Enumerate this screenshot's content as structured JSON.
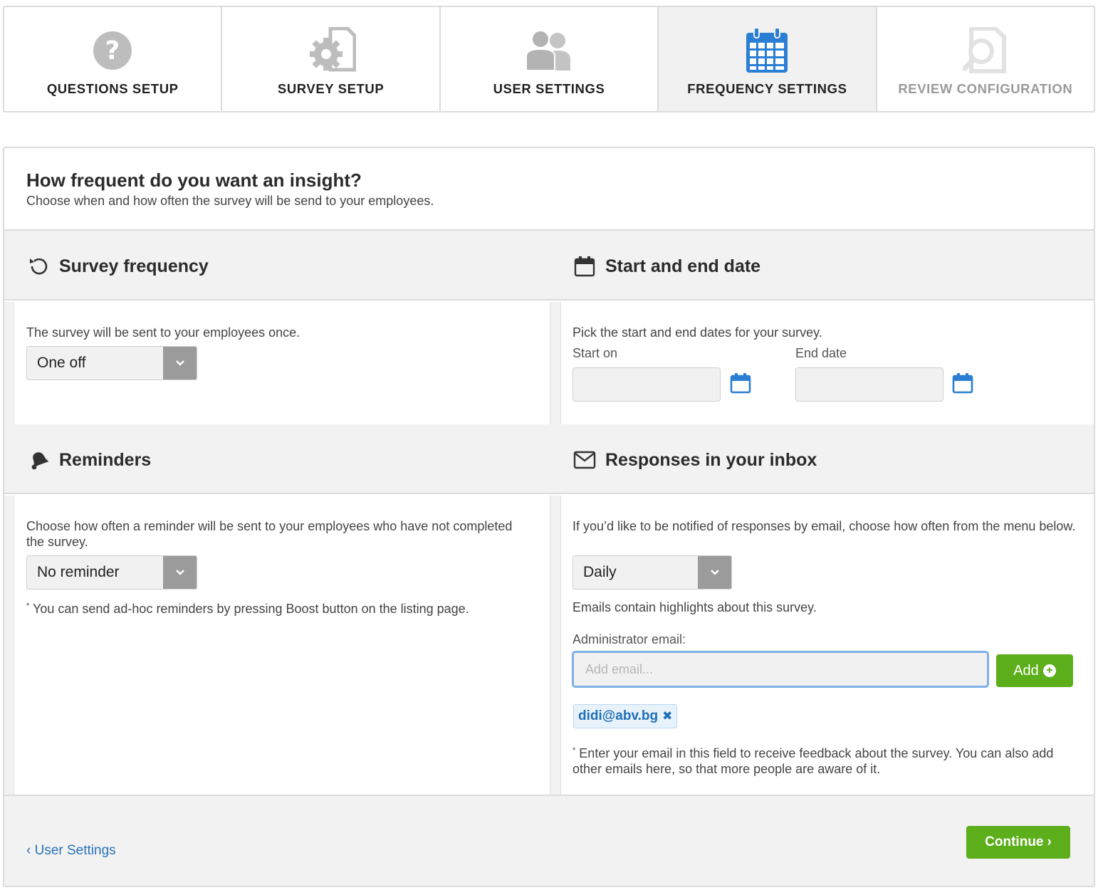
{
  "steps": [
    {
      "label": "QUESTIONS SETUP",
      "icon": "question-circle-icon",
      "state": "done"
    },
    {
      "label": "SURVEY SETUP",
      "icon": "gear-document-icon",
      "state": "done"
    },
    {
      "label": "USER SETTINGS",
      "icon": "users-icon",
      "state": "done"
    },
    {
      "label": "FREQUENCY SETTINGS",
      "icon": "calendar-icon",
      "state": "active"
    },
    {
      "label": "REVIEW CONFIGURATION",
      "icon": "magnifier-document-icon",
      "state": "disabled"
    }
  ],
  "header": {
    "title": "How frequent do you want an insight?",
    "subtitle": "Choose when and how often the survey will be send to your employees."
  },
  "frequency": {
    "heading": "Survey frequency",
    "description": "The survey will be sent to your employees once.",
    "selected": "One off"
  },
  "dates": {
    "heading": "Start and end date",
    "description": "Pick the start and end dates for your survey.",
    "start_label": "Start on",
    "end_label": "End date",
    "start_value": "",
    "end_value": ""
  },
  "reminders": {
    "heading": "Reminders",
    "description": "Choose how often a reminder will be sent to your employees who have not completed the survey.",
    "selected": "No reminder",
    "note": "You can send ad-hoc reminders by pressing Boost button on the listing page."
  },
  "inbox": {
    "heading": "Responses in your inbox",
    "description": "If you’d like to be notified of responses by email, choose how often from the menu below.",
    "selected": "Daily",
    "highlights": "Emails contain highlights about this survey.",
    "admin_label": "Administrator email:",
    "email_placeholder": "Add email...",
    "add_label": "Add",
    "emails": [
      "didi@abv.bg"
    ],
    "note": "Enter your email in this field to receive feedback about the survey. You can also add other emails here, so that more people are aware of it."
  },
  "footer": {
    "back_label": "User Settings",
    "continue_label": "Continue"
  },
  "colors": {
    "accent_blue": "#2a7fd4",
    "green": "#5cae1b",
    "link": "#2a72b8"
  }
}
